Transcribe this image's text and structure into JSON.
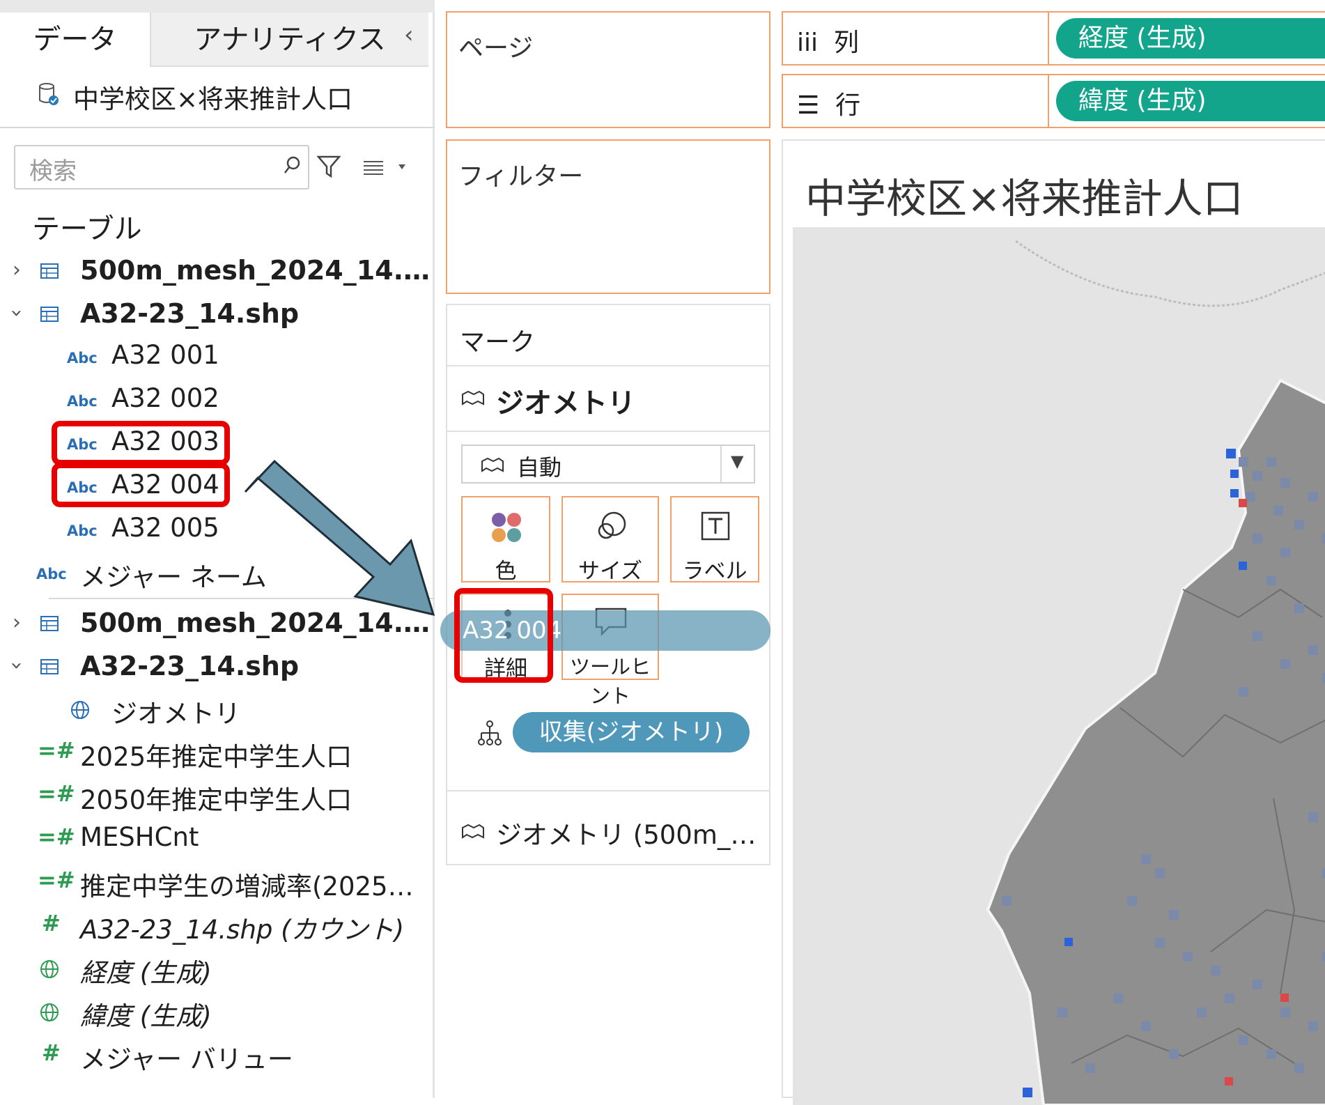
{
  "data_pane": {
    "tabs": [
      "データ",
      "アナリティクス"
    ],
    "collapse_glyph": "‹",
    "datasource": "中学校区×将来推計人口",
    "search_placeholder": "検索",
    "tables_heading": "テーブル",
    "table1": "500m_mesh_2024_14.…",
    "table2": "A32-23_14.shp",
    "dims": [
      "A32 001",
      "A32 002",
      "A32 003",
      "A32 004",
      "A32 005"
    ],
    "abc": "Abc",
    "measure_names": "メジャー ネーム",
    "table3": "500m_mesh_2024_14.…",
    "table4": "A32-23_14.shp",
    "geometry_field": "ジオメトリ",
    "measures": [
      "2025年推定中学生人口",
      "2050年推定中学生人口",
      "MESHCnt",
      "推定中学生の増減率(2025…",
      "A32-23_14.shp (カウント)",
      "経度 (生成)",
      "緯度 (生成)",
      "メジャー バリュー"
    ]
  },
  "shelves": {
    "pages": "ページ",
    "filters": "フィルター",
    "columns_label": "列",
    "rows_label": "行",
    "columns_pill": "経度 (生成)",
    "rows_pill": "緯度 (生成)"
  },
  "marks": {
    "title": "マーク",
    "layer1": "ジオメトリ",
    "mark_type": "自動",
    "buttons": {
      "color": "色",
      "size": "サイズ",
      "label": "ラベル",
      "detail": "詳細",
      "tooltip": "ツールヒント"
    },
    "collect_pill": "収集(ジオメトリ)",
    "layer2": "ジオメトリ (500m_…",
    "drag_pill": "A32 004"
  },
  "viz": {
    "title": "中学校区×将来推計人口"
  },
  "colors": {
    "accent_orange": "#f0a06a",
    "pill_green": "#13a58b",
    "pill_blue": "#4f98ba",
    "highlight_red": "#e60000",
    "arrow": "#6b98ad"
  }
}
